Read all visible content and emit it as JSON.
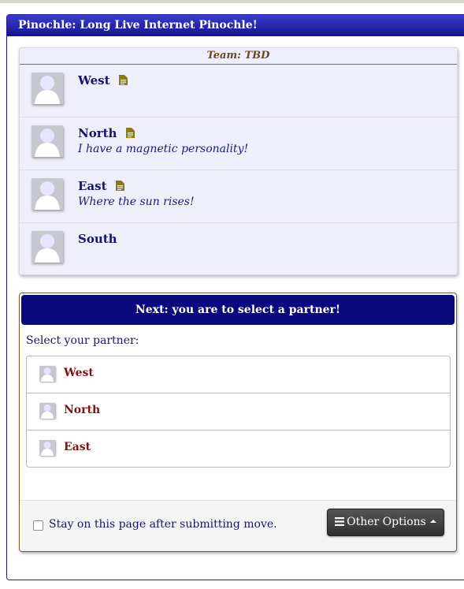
{
  "window": {
    "title": "Pinochle: Long Live Internet Pinochle!"
  },
  "team": {
    "title": "Team: TBD",
    "players": [
      {
        "name": "West",
        "quote": "",
        "has_note": true
      },
      {
        "name": "North",
        "quote": "I have a magnetic personality!",
        "has_note": true
      },
      {
        "name": "East",
        "quote": "Where the sun rises!",
        "has_note": true
      },
      {
        "name": "South",
        "quote": "",
        "has_note": false
      }
    ]
  },
  "selection": {
    "banner": "Next: you are to select a partner!",
    "prompt": "Select your partner:",
    "choices": [
      "West",
      "North",
      "East"
    ]
  },
  "footer": {
    "stay_label": "Stay on this page after submitting move.",
    "stay_checked": false,
    "options_label": "Other Options"
  },
  "colors": {
    "accent": "#0a0a7c",
    "choice_text": "#7a1414",
    "note_icon": "#8a7a14"
  },
  "icons": [
    "avatar-icon",
    "document-icon",
    "hamburger-icon",
    "caret-up-icon"
  ]
}
